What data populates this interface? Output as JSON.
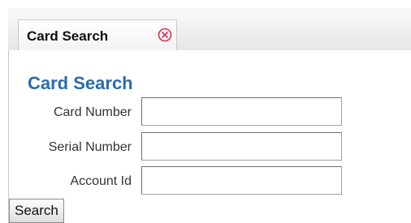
{
  "tab": {
    "label": "Card Search",
    "close_icon": "circle-x-icon",
    "close_color": "#e0304a"
  },
  "page": {
    "title": "Card Search",
    "title_color": "#2a6ab1"
  },
  "fields": [
    {
      "label": "Card Number",
      "value": ""
    },
    {
      "label": "Serial Number",
      "value": ""
    },
    {
      "label": "Account Id",
      "value": ""
    }
  ],
  "search_button": {
    "label": "Search"
  }
}
